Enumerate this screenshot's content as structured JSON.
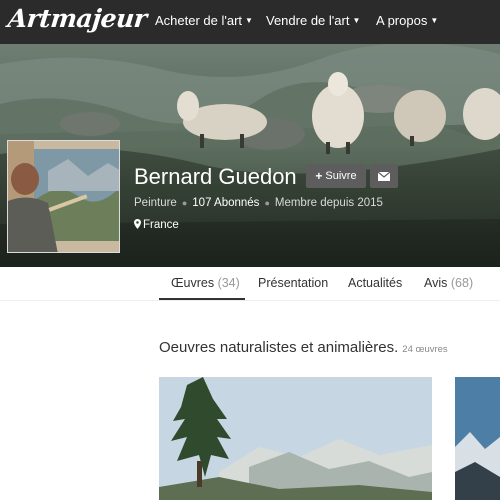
{
  "nav": {
    "logo": "Artmajeur",
    "items": [
      {
        "label": "Acheter de l'art"
      },
      {
        "label": "Vendre de l'art"
      },
      {
        "label": "A propos"
      }
    ]
  },
  "profile": {
    "name": "Bernard Guedon",
    "follow_label": "Suivre",
    "category": "Peinture",
    "followers": "107 Abonnés",
    "member_since": "Membre depuis 2015",
    "location": "France"
  },
  "tabs": [
    {
      "label": "Œuvres",
      "count": "(34)"
    },
    {
      "label": "Présentation",
      "count": ""
    },
    {
      "label": "Actualités",
      "count": ""
    },
    {
      "label": "Avis",
      "count": "(68)"
    }
  ],
  "section": {
    "title": "Oeuvres naturalistes et animalières.",
    "count": "24 œuvres"
  },
  "colors": {
    "nav_bg": "#2b2b2b",
    "button_bg": "#5d5d5d",
    "active_tab_underline": "#333333"
  }
}
